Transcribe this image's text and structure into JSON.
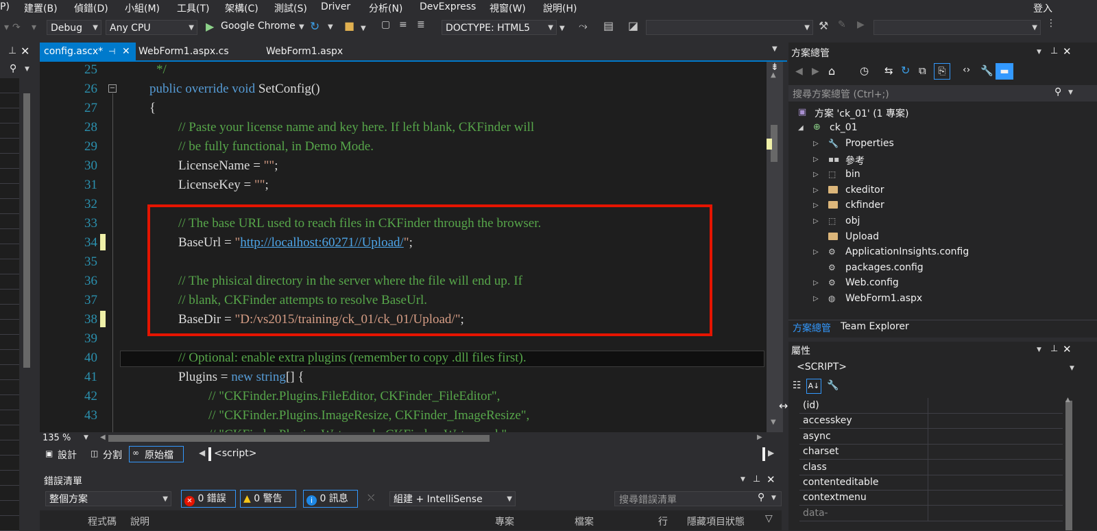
{
  "menu": {
    "items": [
      "P)",
      "建置(B)",
      "偵錯(D)",
      "小組(M)",
      "工具(T)",
      "架構(C)",
      "測試(S)",
      "Driver",
      "分析(N)",
      "DevExpress",
      "視窗(W)",
      "說明(H)"
    ],
    "signin": "登入"
  },
  "toolbar": {
    "config": "Debug",
    "platform": "Any CPU",
    "browser": "Google Chrome",
    "doctype": "DOCTYPE: HTML5"
  },
  "tabs": [
    {
      "label": "config.ascx*",
      "active": true
    },
    {
      "label": "WebForm1.aspx.cs",
      "active": false
    },
    {
      "label": "WebForm1.aspx",
      "active": false
    }
  ],
  "editor": {
    "line_numbers": [
      "25",
      "26",
      "27",
      "28",
      "29",
      "30",
      "31",
      "32",
      "33",
      "34",
      "35",
      "36",
      "37",
      "38",
      "39",
      "40",
      "41",
      "42",
      "43"
    ],
    "zoom": "135 %"
  },
  "view_bar": {
    "design": "設計",
    "split": "分割",
    "source": "原始檔",
    "element": "<script>"
  },
  "error_list": {
    "title": "錯誤清單",
    "scope": "整個方案",
    "errors": "0 錯誤",
    "warnings": "0 警告",
    "messages": "0 訊息",
    "build": "組建 + IntelliSense",
    "search_placeholder": "搜尋錯誤清單",
    "col_code": "程式碼",
    "col_desc": "說明",
    "col_project": "專案",
    "col_file": "檔案",
    "col_line": "行",
    "col_suppress": "隱藏項目狀態"
  },
  "solution_explorer": {
    "title": "方案總管",
    "search_placeholder": "搜尋方案總管 (Ctrl+;)",
    "solution": "方案 'ck_01' (1 專案)",
    "project": "ck_01",
    "items": [
      {
        "label": "Properties",
        "icon": "wrench-icon",
        "expandable": true
      },
      {
        "label": "參考",
        "icon": "references-icon",
        "expandable": true
      },
      {
        "label": "bin",
        "icon": "dotted-folder-icon",
        "expandable": true
      },
      {
        "label": "ckeditor",
        "icon": "folder-icon",
        "expandable": true
      },
      {
        "label": "ckfinder",
        "icon": "folder-icon",
        "expandable": true
      },
      {
        "label": "obj",
        "icon": "dotted-folder-icon",
        "expandable": true
      },
      {
        "label": "Upload",
        "icon": "folder-icon",
        "expandable": false
      },
      {
        "label": "ApplicationInsights.config",
        "icon": "config-icon",
        "expandable": true
      },
      {
        "label": "packages.config",
        "icon": "config-icon",
        "expandable": false
      },
      {
        "label": "Web.config",
        "icon": "config-icon",
        "expandable": true
      },
      {
        "label": "WebForm1.aspx",
        "icon": "web-file-icon",
        "expandable": true
      }
    ],
    "bottom_tabs": [
      "方案總管",
      "Team Explorer"
    ]
  },
  "properties": {
    "title": "屬性",
    "object": "<SCRIPT>",
    "rows": [
      "(id)",
      "accesskey",
      "async",
      "charset",
      "class",
      "contenteditable",
      "contextmenu",
      "data-"
    ]
  }
}
